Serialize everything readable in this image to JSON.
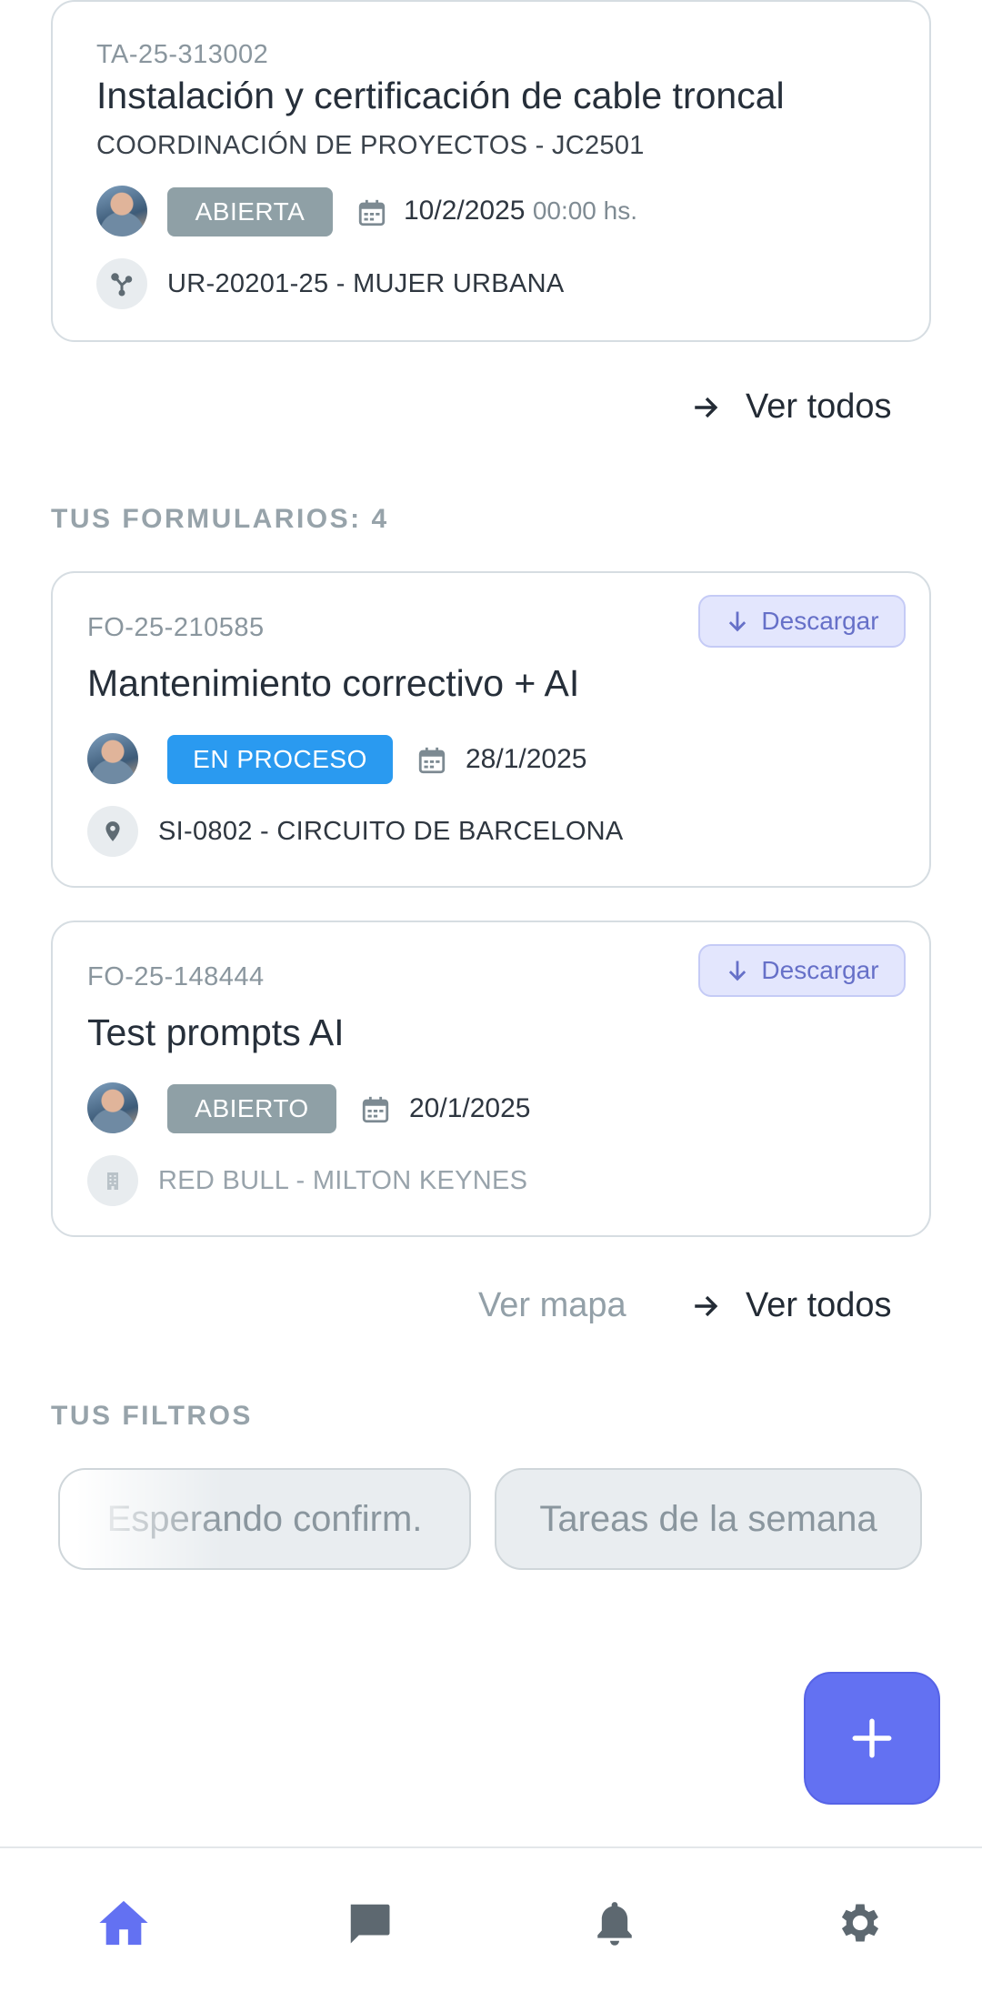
{
  "colors": {
    "accent": "#6371f2",
    "badge_grey": "#8fa0a6",
    "badge_blue": "#2a9af0",
    "download_bg": "#e3e6fd"
  },
  "task_card": {
    "code": "TA-25-313002",
    "title": "Instalación y certificación de cable troncal",
    "subtitle": "COORDINACIÓN DE PROYECTOS - JC2501",
    "status": "ABIERTA",
    "date": "10/2/2025",
    "time": "00:00 hs.",
    "reference": "UR-20201-25 - MUJER URBANA",
    "reference_icon": "branch-nodes-icon"
  },
  "tasks_view_all": "Ver todos",
  "forms": {
    "heading": "TUS FORMULARIOS: 4",
    "items": [
      {
        "code": "FO-25-210585",
        "title": "Mantenimiento correctivo + AI",
        "status": "EN PROCESO",
        "date": "28/1/2025",
        "location": "SI-0802 - CIRCUITO DE BARCELONA",
        "location_icon": "map-pin-icon",
        "download_label": "Descargar"
      },
      {
        "code": "FO-25-148444",
        "title": "Test prompts AI",
        "status": "ABIERTO",
        "date": "20/1/2025",
        "location": "RED BULL - MILTON KEYNES",
        "location_icon": "building-icon",
        "download_label": "Descargar"
      }
    ],
    "view_map": "Ver mapa",
    "view_all": "Ver todos"
  },
  "filters": {
    "heading": "TUS FILTROS",
    "chips": [
      "Esperando confirm.",
      "Tareas de la semana"
    ]
  },
  "fab_icon": "plus-icon",
  "bottom_nav": [
    {
      "icon": "home-icon",
      "active": true
    },
    {
      "icon": "chat-icon",
      "active": false
    },
    {
      "icon": "bell-icon",
      "active": false
    },
    {
      "icon": "gear-icon",
      "active": false
    }
  ]
}
